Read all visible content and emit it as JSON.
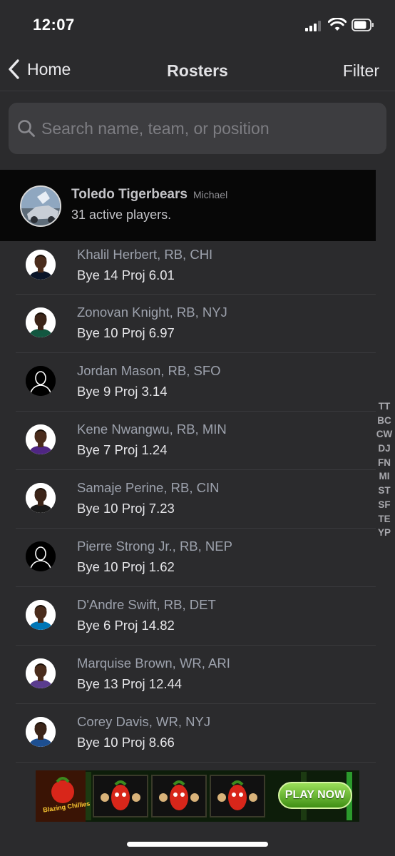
{
  "status_bar": {
    "time": "12:07"
  },
  "nav": {
    "back_label": "Home",
    "title": "Rosters",
    "filter_label": "Filter"
  },
  "search": {
    "placeholder": "Search name, team, or position",
    "value": ""
  },
  "team": {
    "name": "Toledo Tigerbears",
    "owner": "Michael",
    "subtitle": "31 active players."
  },
  "players": [
    {
      "name": "Khalil Herbert, RB, CHI",
      "stats": "Bye 14 Proj 6.01",
      "avatar": "photo",
      "jersey": "#0b162a",
      "skin": "#4a2c1c"
    },
    {
      "name": "Zonovan Knight, RB, NYJ",
      "stats": "Bye 10 Proj 6.97",
      "avatar": "photo",
      "jersey": "#125740",
      "skin": "#3b2418"
    },
    {
      "name": "Jordan Mason, RB, SFO",
      "stats": "Bye 9 Proj 3.14",
      "avatar": "silhouette",
      "jersey": "#000000",
      "skin": "#000000"
    },
    {
      "name": "Kene Nwangwu, RB, MIN",
      "stats": "Bye 7 Proj 1.24",
      "avatar": "photo",
      "jersey": "#4f2683",
      "skin": "#4a2c1c"
    },
    {
      "name": "Samaje Perine, RB, CIN",
      "stats": "Bye 10 Proj 7.23",
      "avatar": "photo",
      "jersey": "#1a1a1a",
      "skin": "#3b2418"
    },
    {
      "name": "Pierre Strong Jr., RB, NEP",
      "stats": "Bye 10 Proj 1.62",
      "avatar": "silhouette",
      "jersey": "#000000",
      "skin": "#000000"
    },
    {
      "name": "D'Andre Swift, RB, DET",
      "stats": "Bye 6 Proj 14.82",
      "avatar": "photo",
      "jersey": "#0076b6",
      "skin": "#4a2c1c"
    },
    {
      "name": "Marquise Brown, WR, ARI",
      "stats": "Bye 13 Proj 12.44",
      "avatar": "photo",
      "jersey": "#5a3c8e",
      "skin": "#4a2c1c"
    },
    {
      "name": "Corey Davis, WR, NYJ",
      "stats": "Bye 10 Proj 8.66",
      "avatar": "photo",
      "jersey": "#1d4f91",
      "skin": "#3b2418"
    }
  ],
  "index_letters": [
    "TT",
    "BC",
    "CW",
    "DJ",
    "FN",
    "MI",
    "ST",
    "SF",
    "TE",
    "YP"
  ],
  "ad": {
    "logo_text": "Blazing Chillies",
    "cta": "PLAY NOW"
  },
  "icons": {
    "back": "chevron-left-icon",
    "search": "search-icon",
    "signal": "cellular-signal-icon",
    "wifi": "wifi-icon",
    "battery": "battery-icon"
  }
}
